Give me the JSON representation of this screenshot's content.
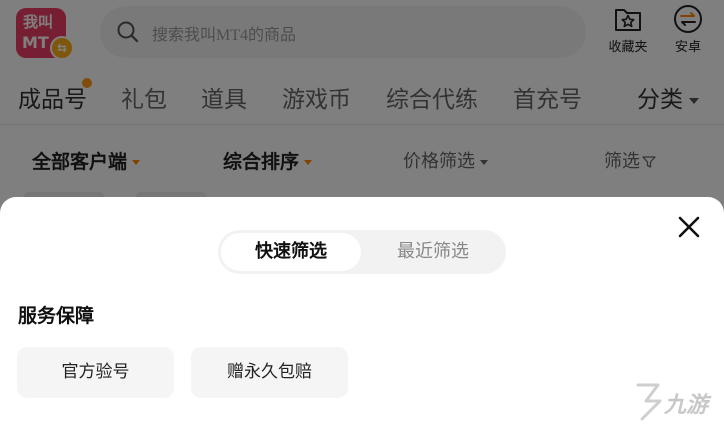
{
  "header": {
    "logo_line1": "我叫",
    "logo_line2": "MT",
    "search_placeholder": "搜索我叫MT4的商品",
    "favorites_label": "收藏夹",
    "platform_label": "安卓"
  },
  "tabs": [
    {
      "label": "成品号"
    },
    {
      "label": "礼包"
    },
    {
      "label": "道具"
    },
    {
      "label": "游戏币"
    },
    {
      "label": "综合代练"
    },
    {
      "label": "首充号"
    },
    {
      "label": "分类"
    }
  ],
  "filters": {
    "client": "全部客户端",
    "sort": "综合排序",
    "price": "价格筛选",
    "filter": "筛选"
  },
  "sheet": {
    "segment": {
      "active": "快速筛选",
      "inactive": "最近筛选"
    },
    "section_title": "服务保障",
    "options": [
      "官方验号",
      "赠永久包赔"
    ]
  },
  "watermark": "九游",
  "colors": {
    "brand": "#ef3e64",
    "accent_orange": "#ff8a00",
    "overlay": "rgba(0,0,0,0.5)"
  },
  "icons": [
    "search-icon",
    "star-folder-icon",
    "swap-arrows-icon",
    "close-icon",
    "filter-icon"
  ]
}
